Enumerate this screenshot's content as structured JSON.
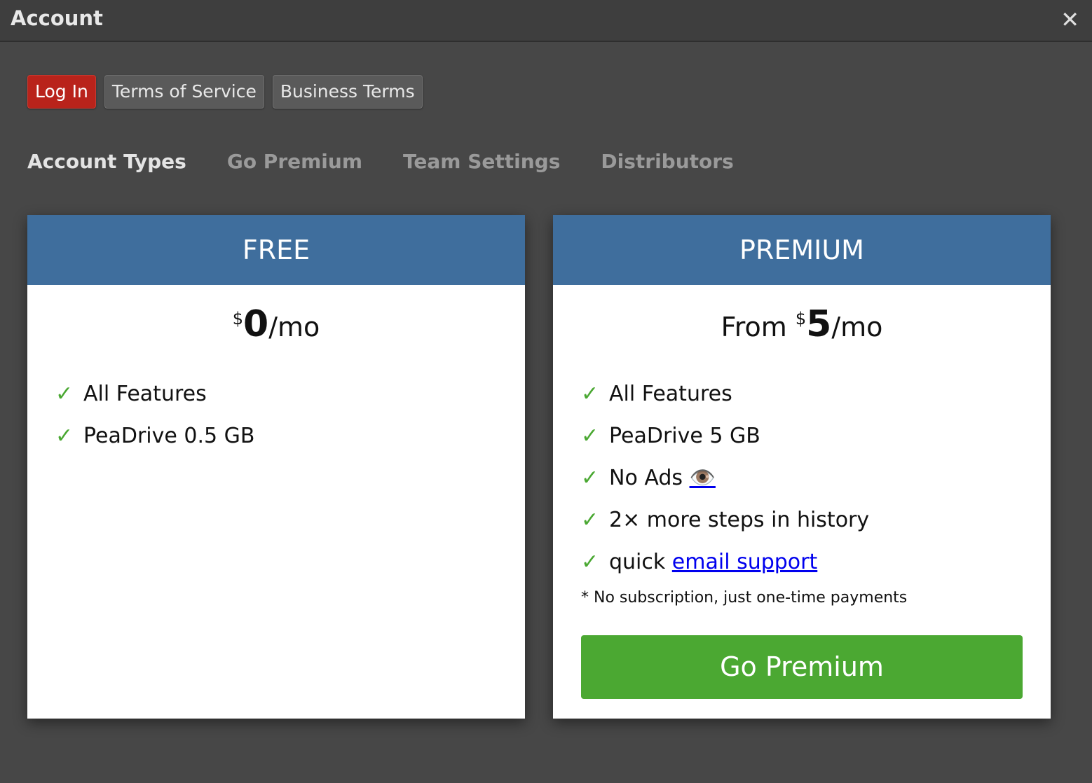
{
  "window": {
    "title": "Account",
    "close_glyph": "✕"
  },
  "buttons": {
    "login": "Log In",
    "tos": "Terms of Service",
    "business": "Business Terms"
  },
  "tabs": [
    "Account Types",
    "Go Premium",
    "Team Settings",
    "Distributors"
  ],
  "active_tab": "Account Types",
  "free": {
    "header": "FREE",
    "currency": "$",
    "amount": "0",
    "period": "/mo",
    "features": [
      "All Features",
      "PeaDrive 0.5 GB"
    ]
  },
  "premium": {
    "header": "PREMIUM",
    "prefix": "From ",
    "currency": "$",
    "amount": "5",
    "period": "/mo",
    "features": [
      "All Features",
      "PeaDrive 5 GB",
      "No Ads",
      "2× more steps in history",
      "quick "
    ],
    "ads_link": "👁️",
    "email_link": "email support",
    "note": "* No subscription, just one-time payments",
    "cta": "Go Premium"
  },
  "colors": {
    "background": "#474747",
    "header_blue": "#3f6e9d",
    "cta_green": "#4ba832",
    "login_red": "#b9231b",
    "check_green": "#4aa832"
  },
  "icons": {
    "check": "✓"
  }
}
